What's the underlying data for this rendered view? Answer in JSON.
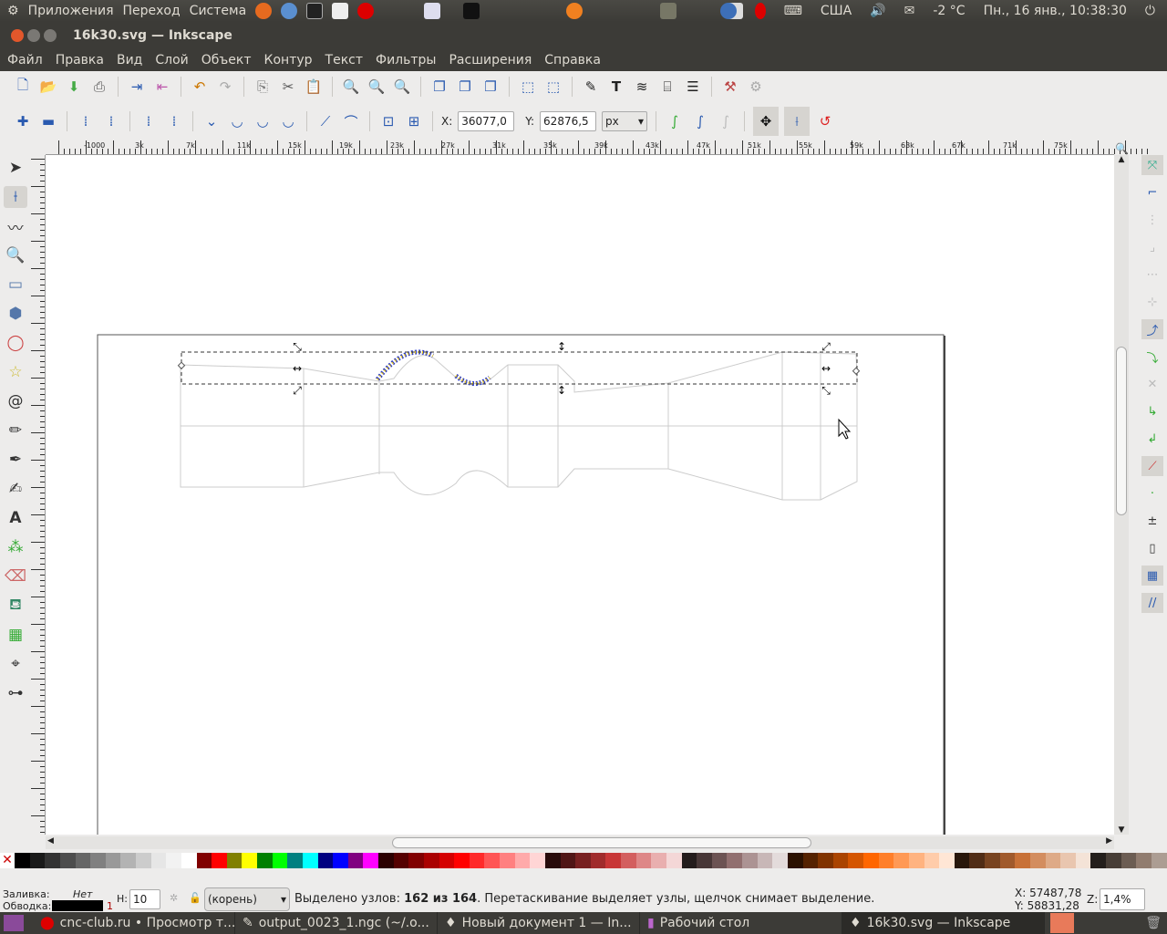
{
  "top_panel": {
    "menus": [
      "Приложения",
      "Переход",
      "Система"
    ],
    "keyboard": "США",
    "weather": "-2 °C",
    "clock": "Пн., 16 янв., 10:38:30"
  },
  "window": {
    "title": "16k30.svg — Inkscape"
  },
  "menu": [
    "Файл",
    "Правка",
    "Вид",
    "Слой",
    "Объект",
    "Контур",
    "Текст",
    "Фильтры",
    "Расширения",
    "Справка"
  ],
  "node_toolbar": {
    "x_label": "X:",
    "x_value": "36077,0",
    "y_label": "Y:",
    "y_value": "62876,5",
    "unit": "px"
  },
  "ruler": {
    "ticks": [
      "-1000",
      "3k",
      "7k",
      "11k",
      "15k",
      "19k",
      "23k",
      "27k",
      "31k",
      "35k",
      "39k",
      "43k",
      "47k",
      "51k",
      "55k",
      "59k",
      "63k",
      "67k",
      "71k",
      "75k"
    ]
  },
  "status": {
    "fill_label": "Заливка:",
    "fill_value": "Нет",
    "stroke_label": "Обводка:",
    "stroke_width": "1",
    "h_label": "H:",
    "h_value": "10",
    "layer": "(корень)",
    "message_prefix": "Выделено узлов: ",
    "message_bold": "162 из 164",
    "message_suffix": ". Перетаскивание выделяет узлы, щелчок снимает выделение.",
    "cursor_x": "X: 57487,78",
    "cursor_y": "Y: 58831,28",
    "zoom_label": "Z:",
    "zoom_value": "1,4%"
  },
  "taskbar": [
    "cnc-club.ru • Просмотр т...",
    "output_0023_1.ngc (~/.o...",
    "Новый документ 1 — In...",
    "Рабочий стол",
    "16k30.svg — Inkscape"
  ],
  "palette": [
    "#000000",
    "#1a1a1a",
    "#333333",
    "#4d4d4d",
    "#666666",
    "#808080",
    "#999999",
    "#b3b3b3",
    "#cccccc",
    "#e6e6e6",
    "#f2f2f2",
    "#ffffff",
    "#800000",
    "#ff0000",
    "#808000",
    "#ffff00",
    "#008000",
    "#00ff00",
    "#008080",
    "#00ffff",
    "#000080",
    "#0000ff",
    "#800080",
    "#ff00ff",
    "#2b0000",
    "#550000",
    "#800000",
    "#aa0000",
    "#d40000",
    "#ff0000",
    "#ff2a2a",
    "#ff5555",
    "#ff8080",
    "#ffaaaa",
    "#ffd5d5",
    "#280b0b",
    "#501616",
    "#782121",
    "#a02c2c",
    "#c83737",
    "#d35f5f",
    "#de8787",
    "#e9afaf",
    "#f4d7d7",
    "#241c1c",
    "#483737",
    "#6c5353",
    "#916f6f",
    "#ac9393",
    "#c8b7b7",
    "#e3dbdb",
    "#2b1100",
    "#552200",
    "#803300",
    "#aa4400",
    "#d45500",
    "#ff6600",
    "#ff7f2a",
    "#ff9955",
    "#ffb380",
    "#ffccaa",
    "#ffe6d5",
    "#28170b",
    "#502d16",
    "#784421",
    "#a05a2c",
    "#c87137",
    "#d38d5f",
    "#deaa87",
    "#e9c6af",
    "#f4e3d7",
    "#241f1c",
    "#483e37",
    "#6c5d53",
    "#917c6f",
    "#ac9d93"
  ]
}
